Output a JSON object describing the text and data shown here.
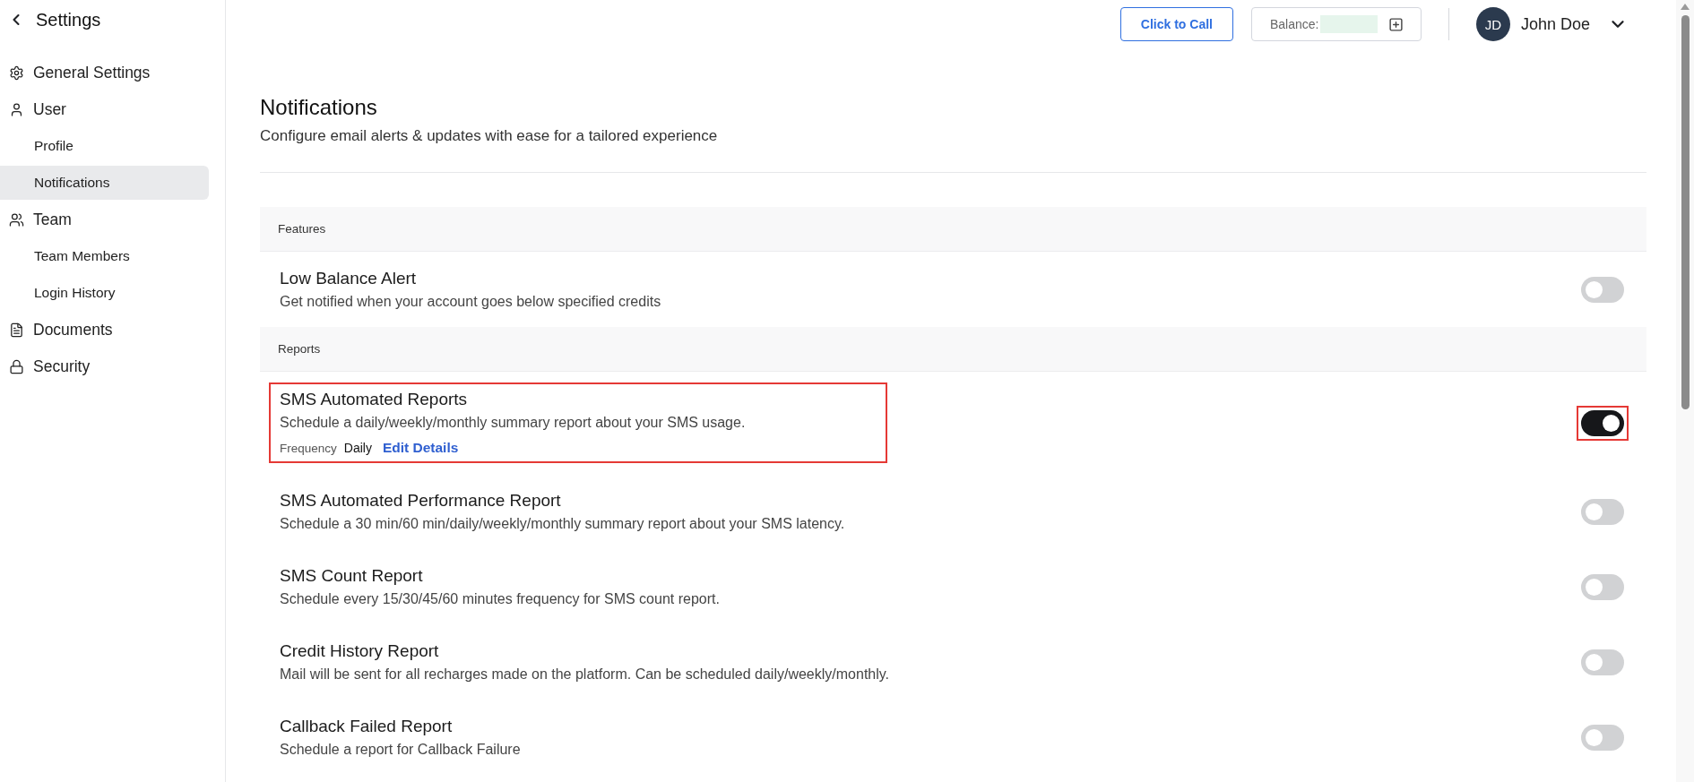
{
  "sidebar": {
    "title": "Settings",
    "items": [
      {
        "kind": "section",
        "label": "General Settings",
        "selected": false
      },
      {
        "kind": "section",
        "label": "User",
        "selected": false
      },
      {
        "kind": "sub",
        "label": "Profile",
        "selected": false
      },
      {
        "kind": "sub",
        "label": "Notifications",
        "selected": true
      },
      {
        "kind": "section",
        "label": "Team",
        "selected": false
      },
      {
        "kind": "sub",
        "label": "Team Members",
        "selected": false
      },
      {
        "kind": "sub",
        "label": "Login History",
        "selected": false
      },
      {
        "kind": "section",
        "label": "Documents",
        "selected": false
      },
      {
        "kind": "section",
        "label": "Security",
        "selected": false
      }
    ]
  },
  "topbar": {
    "call_button": "Click to Call",
    "balance_label": "Balance:",
    "user": {
      "initials": "JD",
      "name": "John Doe"
    }
  },
  "page": {
    "title": "Notifications",
    "subtitle": "Configure email alerts & updates with ease for a tailored experience"
  },
  "sections": [
    {
      "title": "Features",
      "items": [
        {
          "title": "Low Balance Alert",
          "description": "Get notified when your account goes below specified credits",
          "on": false
        }
      ]
    },
    {
      "title": "Reports",
      "items": [
        {
          "title": "SMS Automated Reports",
          "description": "Schedule a daily/weekly/monthly summary report about your SMS usage.",
          "frequency_label": "Frequency",
          "frequency": "Daily",
          "link": "Edit Details",
          "on": true,
          "highlighted": true
        },
        {
          "title": "SMS Automated Performance Report",
          "description": "Schedule a 30 min/60 min/daily/weekly/monthly summary report about your SMS latency.",
          "on": false
        },
        {
          "title": "SMS Count Report",
          "description": "Schedule every 15/30/45/60 minutes frequency for SMS count report.",
          "on": false
        },
        {
          "title": "Credit History Report",
          "description": "Mail will be sent for all recharges made on the platform. Can be scheduled daily/weekly/monthly.",
          "on": false
        },
        {
          "title": "Callback Failed Report",
          "description": "Schedule a report for Callback Failure",
          "on": false
        }
      ]
    }
  ]
}
